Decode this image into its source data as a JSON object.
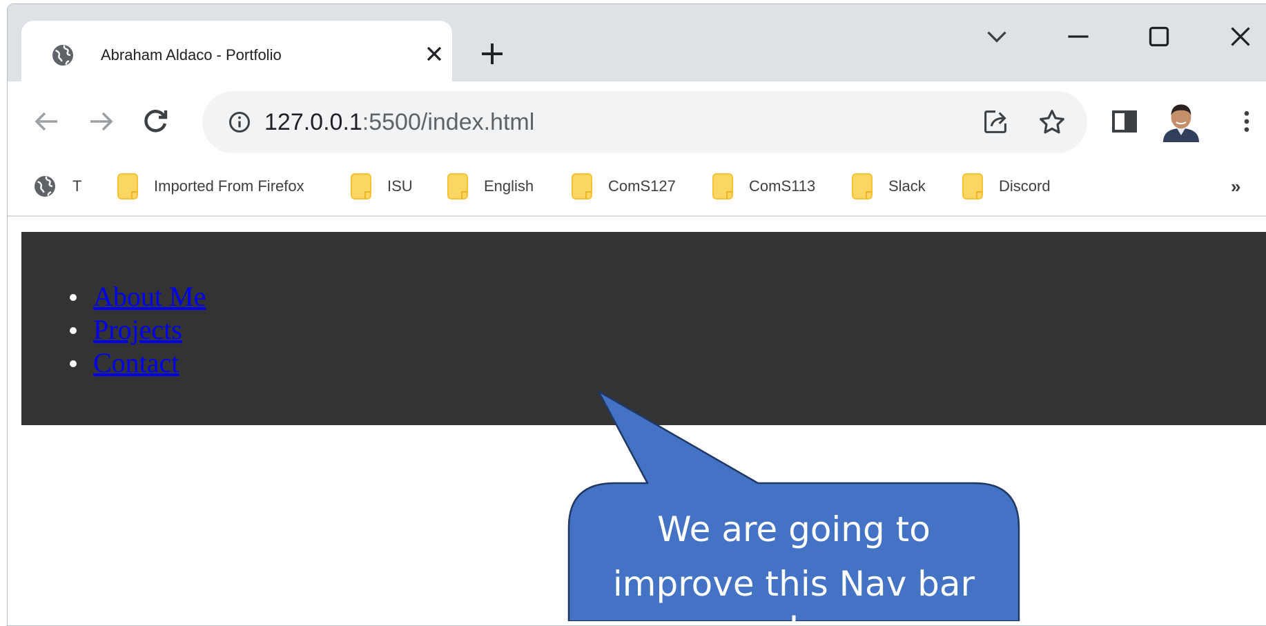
{
  "browser": {
    "tab": {
      "title": "Abraham Aldaco - Portfolio",
      "favicon": "globe-icon"
    },
    "url": {
      "host": "127.0.0.1",
      "rest": ":5500/index.html"
    },
    "bookmarks": [
      {
        "label": "T",
        "icon": "globe-icon"
      },
      {
        "label": "Imported From Firefox",
        "icon": "folder-icon"
      },
      {
        "label": "ISU",
        "icon": "folder-icon"
      },
      {
        "label": "English",
        "icon": "folder-icon"
      },
      {
        "label": "ComS127",
        "icon": "folder-icon"
      },
      {
        "label": "ComS113",
        "icon": "folder-icon"
      },
      {
        "label": "Slack",
        "icon": "folder-icon"
      },
      {
        "label": "Discord",
        "icon": "folder-icon"
      }
    ],
    "bookmarks_overflow": "»"
  },
  "page": {
    "nav_links": [
      "About Me",
      "Projects",
      "Contact"
    ],
    "nav_background": "#333333",
    "link_color": "#0000ee"
  },
  "callout": {
    "lines": [
      "We are going to",
      "improve this Nav bar",
      "!"
    ],
    "fill": "#4472c4"
  }
}
